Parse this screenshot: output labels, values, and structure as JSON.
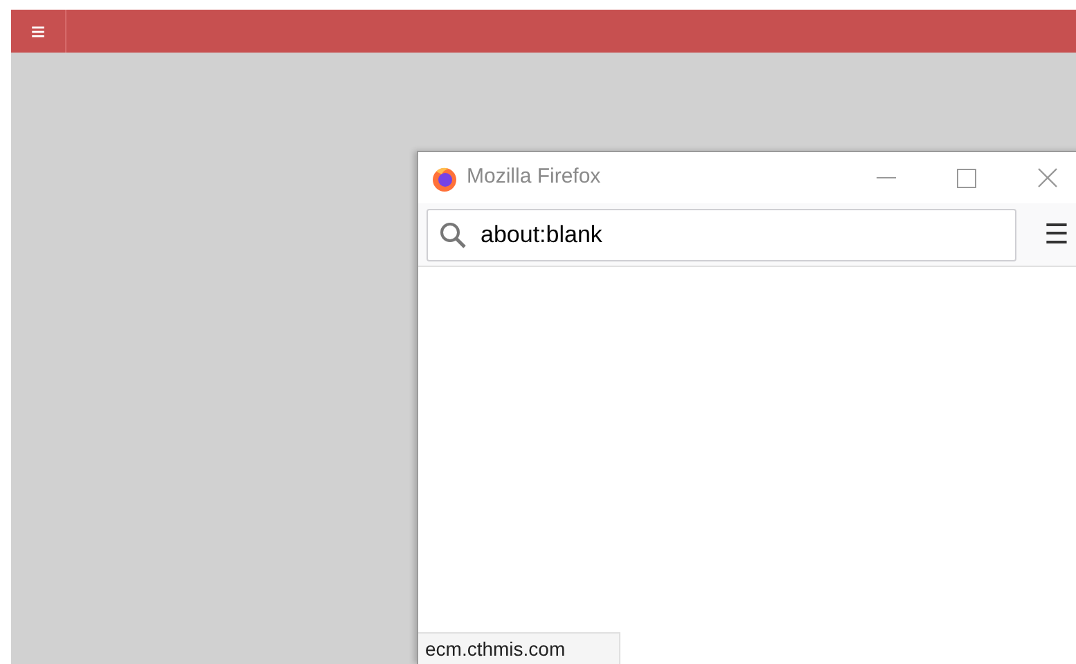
{
  "app_bar": {
    "menu_icon": "≡"
  },
  "browser_window": {
    "title": "Mozilla Firefox",
    "address": "about:blank",
    "menu_icon": "☰",
    "status_text": "ecm.cthmis.com"
  }
}
